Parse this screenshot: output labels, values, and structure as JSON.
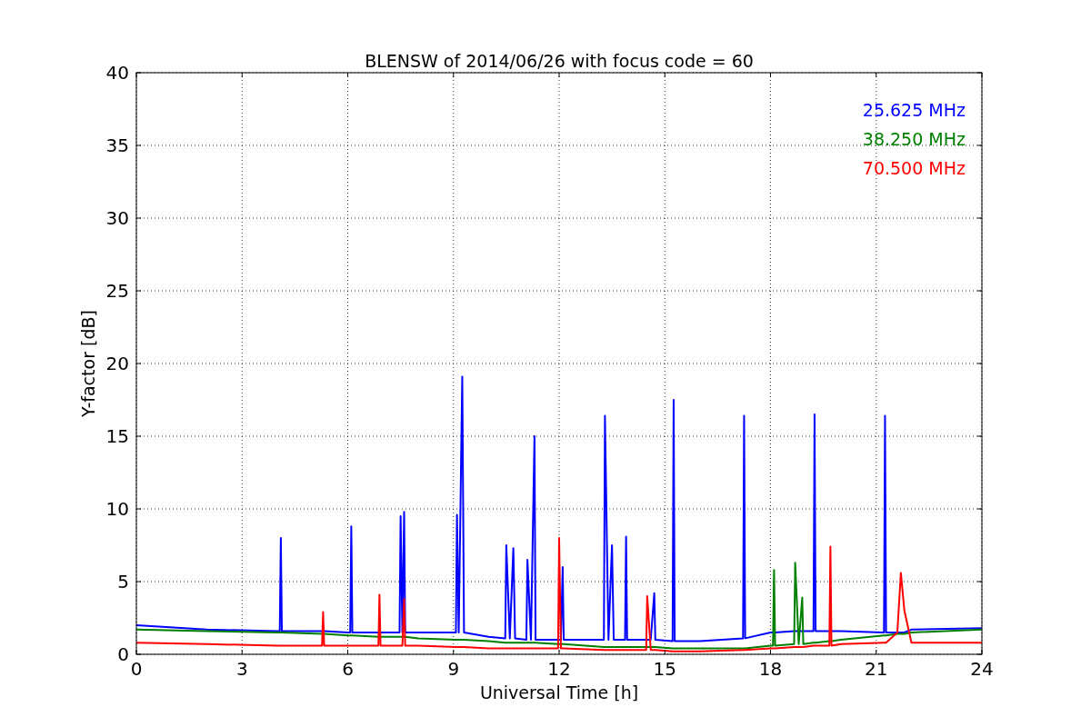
{
  "chart_data": {
    "type": "line",
    "title": "BLENSW of 2014/06/26 with focus code = 60",
    "xlabel": "Universal Time [h]",
    "ylabel": "Y-factor [dB]",
    "xlim": [
      0,
      24
    ],
    "ylim": [
      0,
      40
    ],
    "grid": true,
    "xticks": [
      0,
      3,
      6,
      9,
      12,
      15,
      18,
      21,
      24
    ],
    "yticks": [
      0,
      5,
      10,
      15,
      20,
      25,
      30,
      35,
      40
    ],
    "x": [
      0,
      2,
      4,
      4.07,
      4.1,
      4.13,
      5.27,
      5.3,
      5.33,
      6,
      6.07,
      6.1,
      6.13,
      6.87,
      6.9,
      6.93,
      7.47,
      7.5,
      7.55,
      7.6,
      7.63,
      8,
      9.07,
      9.1,
      9.15,
      9.25,
      9.3,
      10,
      10.47,
      10.5,
      10.6,
      10.7,
      10.75,
      11.07,
      11.1,
      11.2,
      11.3,
      11.33,
      11.97,
      12,
      12.05,
      12.1,
      12.13,
      13.27,
      13.3,
      13.4,
      13.5,
      13.55,
      13.87,
      13.9,
      13.93,
      14,
      14.47,
      14.5,
      14.6,
      14.7,
      14.73,
      15.22,
      15.25,
      15.28,
      16,
      17.22,
      17.25,
      17.28,
      18,
      18.07,
      18.1,
      18.13,
      18.67,
      18.7,
      18.8,
      18.9,
      18.93,
      19.22,
      19.25,
      19.28,
      19.67,
      19.7,
      19.73,
      20,
      21.22,
      21.25,
      21.28,
      21.6,
      21.7,
      21.8,
      22,
      24
    ],
    "series": [
      {
        "name": "25.625 MHz",
        "color": "#0000ff",
        "values": [
          2.0,
          1.7,
          1.6,
          1.6,
          8.0,
          1.6,
          1.6,
          1.6,
          1.6,
          1.5,
          1.5,
          8.8,
          1.5,
          1.5,
          1.5,
          1.5,
          1.5,
          9.5,
          1.5,
          9.8,
          1.5,
          1.5,
          1.5,
          9.6,
          1.5,
          19.1,
          1.5,
          1.2,
          1.1,
          7.5,
          1.1,
          7.3,
          1.1,
          1.0,
          6.5,
          1.0,
          15.0,
          1.0,
          1.0,
          1.0,
          1.0,
          6.0,
          1.0,
          1.0,
          16.4,
          1.0,
          7.5,
          1.0,
          1.0,
          8.1,
          1.0,
          1.0,
          1.0,
          1.0,
          1.0,
          4.2,
          1.0,
          0.9,
          17.5,
          0.9,
          0.9,
          1.1,
          16.4,
          1.1,
          1.5,
          1.5,
          1.5,
          1.5,
          1.6,
          1.6,
          1.6,
          1.6,
          1.6,
          1.6,
          16.5,
          1.6,
          1.6,
          1.6,
          1.6,
          1.6,
          1.5,
          16.4,
          1.5,
          1.5,
          1.5,
          1.5,
          1.7,
          1.8
        ]
      },
      {
        "name": "38.250 MHz",
        "color": "#008000",
        "values": [
          1.7,
          1.6,
          1.5,
          1.5,
          1.5,
          1.5,
          1.4,
          1.4,
          1.4,
          1.3,
          1.3,
          1.3,
          1.3,
          1.2,
          1.2,
          1.2,
          1.2,
          1.2,
          1.2,
          1.2,
          1.2,
          1.1,
          1.0,
          1.0,
          1.0,
          1.0,
          1.0,
          0.9,
          0.8,
          0.8,
          0.8,
          0.8,
          0.8,
          0.8,
          0.8,
          0.8,
          0.8,
          0.8,
          0.7,
          0.7,
          0.7,
          0.7,
          0.7,
          0.5,
          0.5,
          0.5,
          0.5,
          0.5,
          0.5,
          0.5,
          0.5,
          0.5,
          0.5,
          0.5,
          0.5,
          0.5,
          0.5,
          0.4,
          0.4,
          0.4,
          0.4,
          0.4,
          0.4,
          0.4,
          0.6,
          0.6,
          5.8,
          0.6,
          0.7,
          6.3,
          0.7,
          3.9,
          0.7,
          0.8,
          0.8,
          0.8,
          0.9,
          0.9,
          0.9,
          1.0,
          1.3,
          1.3,
          1.3,
          1.4,
          1.4,
          1.4,
          1.5,
          1.7
        ]
      },
      {
        "name": "70.500 MHz",
        "color": "#ff0000",
        "values": [
          0.8,
          0.7,
          0.6,
          0.6,
          0.6,
          0.6,
          0.6,
          2.9,
          0.6,
          0.6,
          0.6,
          0.6,
          0.6,
          0.6,
          4.1,
          0.6,
          0.6,
          0.6,
          0.6,
          3.8,
          0.6,
          0.6,
          0.5,
          0.5,
          0.5,
          0.5,
          0.5,
          0.4,
          0.4,
          0.4,
          0.4,
          0.4,
          0.4,
          0.4,
          0.4,
          0.4,
          0.4,
          0.4,
          0.4,
          8.0,
          0.4,
          0.4,
          0.4,
          0.3,
          0.3,
          0.3,
          0.3,
          0.3,
          0.3,
          0.3,
          0.3,
          0.3,
          0.3,
          4.0,
          0.3,
          0.3,
          0.3,
          0.2,
          0.2,
          0.2,
          0.2,
          0.3,
          0.3,
          0.3,
          0.4,
          0.4,
          0.4,
          0.4,
          0.5,
          0.5,
          0.5,
          0.5,
          0.5,
          0.6,
          0.6,
          0.6,
          0.6,
          7.4,
          0.6,
          0.7,
          0.8,
          0.8,
          0.8,
          1.5,
          5.6,
          3.0,
          0.8,
          0.8
        ]
      }
    ]
  }
}
